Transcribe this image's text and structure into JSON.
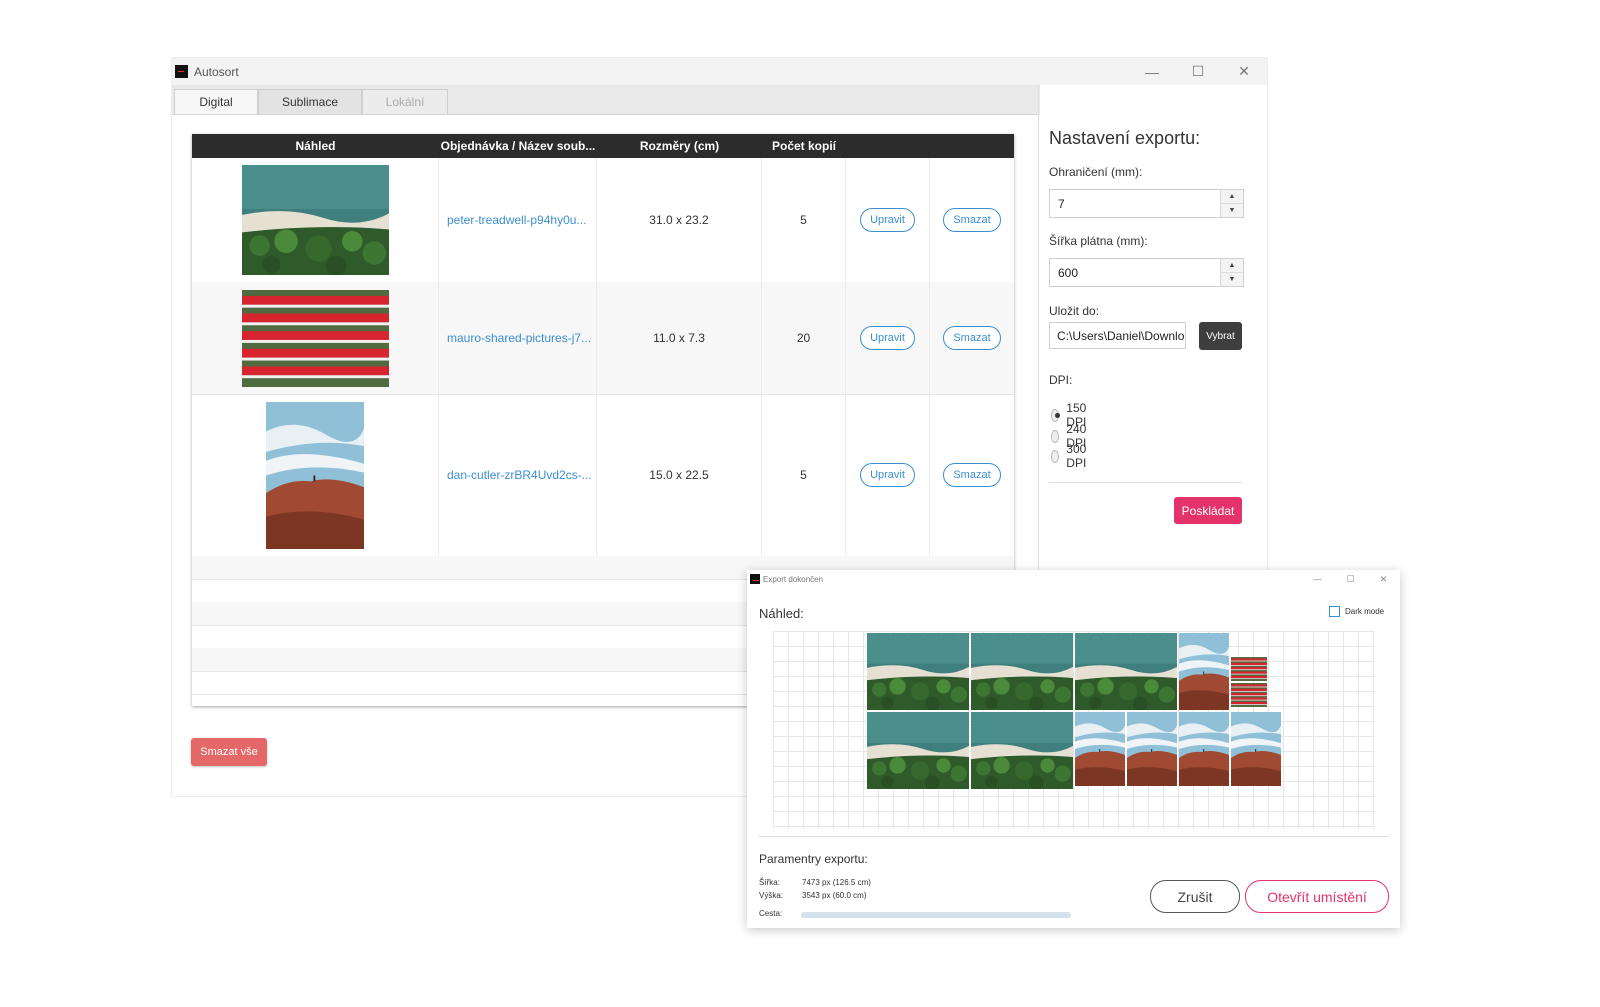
{
  "window": {
    "title": "Autosort",
    "controls": {
      "minimize": "—",
      "maximize": "☐",
      "close": "✕"
    }
  },
  "tabs": [
    {
      "label": "Digital",
      "state": "active"
    },
    {
      "label": "Sublimace",
      "state": "normal"
    },
    {
      "label": "Lokální",
      "state": "disabled"
    }
  ],
  "table": {
    "headers": [
      "Náhled",
      "Objednávka / Název soub...",
      "Rozměry (cm)",
      "Počet kopií"
    ],
    "rows": [
      {
        "name": "peter-treadwell-p94hy0u...",
        "size": "31.0 x 23.2",
        "copies": "5",
        "edit": "Upravit",
        "delete": "Smazat",
        "thumb": "aerial-beach"
      },
      {
        "name": "mauro-shared-pictures-j7...",
        "size": "11.0 x 7.3",
        "copies": "20",
        "edit": "Upravit",
        "delete": "Smazat",
        "thumb": "red-flowerpots"
      },
      {
        "name": "dan-cutler-zrBR4Uvd2cs-...",
        "size": "15.0 x 22.5",
        "copies": "5",
        "edit": "Upravit",
        "delete": "Smazat",
        "thumb": "red-rocks-sky"
      }
    ]
  },
  "clear_all_label": "Smazat vše",
  "export_settings": {
    "title": "Nastavení exportu:",
    "border_label": "Ohraničení (mm):",
    "border_value": "7",
    "canvas_width_label": "Šířka plátna (mm):",
    "canvas_width_value": "600",
    "save_to_label": "Uložit do:",
    "save_to_value": "C:\\Users\\Daniel\\Downlo",
    "choose_label": "Vybrat",
    "dpi_label": "DPI:",
    "dpi_options": [
      {
        "label": "150 DPI",
        "selected": true
      },
      {
        "label": "240 DPI",
        "selected": false
      },
      {
        "label": "300 DPI",
        "selected": false
      }
    ],
    "stack_label": "Poskládat"
  },
  "export_dialog": {
    "title": "Export dokončen",
    "preview_label": "Náhled:",
    "dark_mode_label": "Dark mode",
    "params_label": "Paramentry exportu:",
    "width_key": "Šířka:",
    "width_value": "7473 px (126.5 cm)",
    "height_key": "Výška:",
    "height_value": "3543 px (60.0 cm)",
    "path_key": "Cesta:",
    "cancel_label": "Zrušit",
    "open_label": "Otevřít umístění"
  },
  "colors": {
    "accent_blue": "#3b8ed0",
    "accent_pink": "#e3336a",
    "danger_red": "#e46868",
    "header_dark": "#2c2c2c"
  }
}
